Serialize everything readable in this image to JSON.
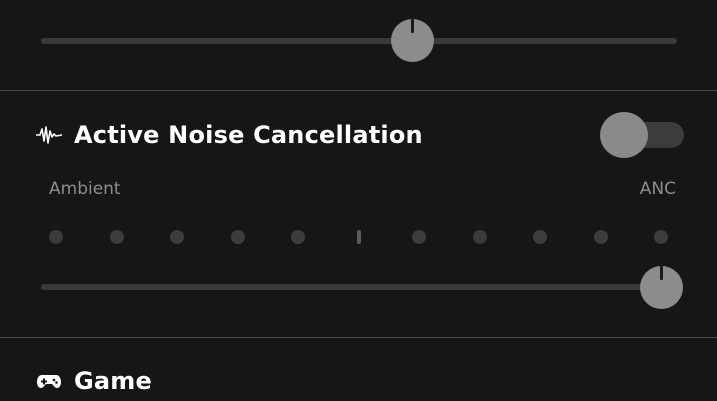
{
  "colors": {
    "background": "#161616",
    "track": "#3a3a3a",
    "knob": "#8c8c8c",
    "divider": "#4a4a4a",
    "label": "#8d8d8d"
  },
  "top_slider": {
    "level": 0.59
  },
  "anc": {
    "icon": "waveform-icon",
    "title": "Active Noise Cancellation",
    "toggle_on": false,
    "scale_left_label": "Ambient",
    "scale_right_label": "ANC",
    "dot_count": 11,
    "level": 1.0
  },
  "game": {
    "icon": "gamepad-icon",
    "title": "Game"
  }
}
